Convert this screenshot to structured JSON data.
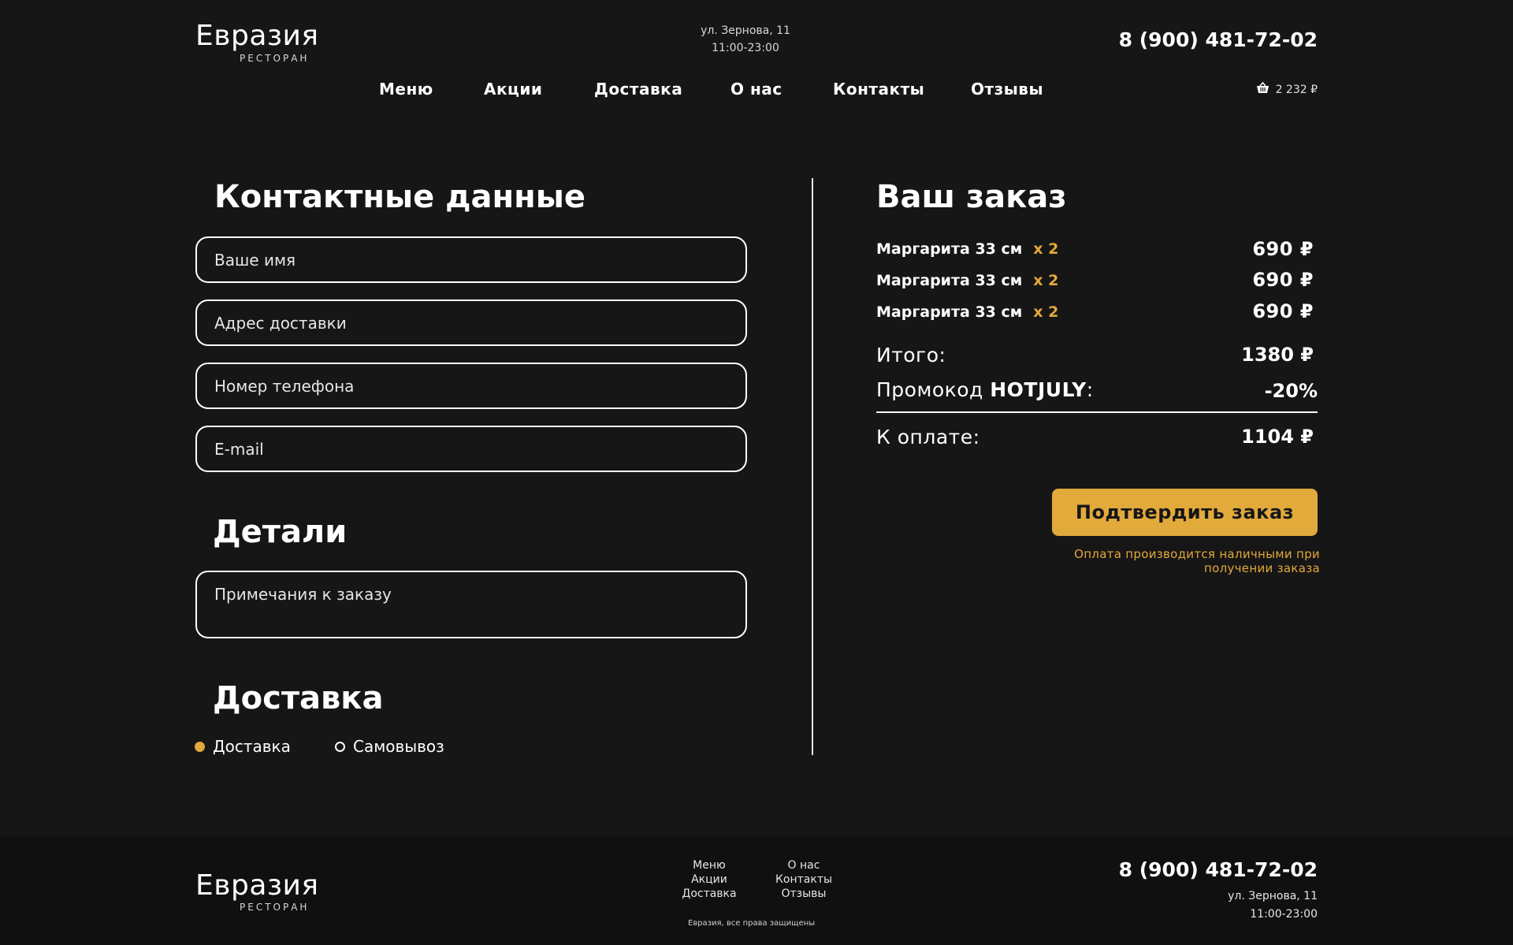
{
  "header": {
    "logo": {
      "name": "Евразия",
      "tagline": "РЕСТОРАН"
    },
    "address": "ул. Зернова, 11",
    "hours": "11:00-23:00",
    "phone": "8 (900) 481-72-02",
    "nav": [
      "Меню",
      "Акции",
      "Доставка",
      "О нас",
      "Контакты",
      "Отзывы"
    ],
    "cart_total": "2 232 ₽"
  },
  "contact": {
    "title": "Контактные данные",
    "fields": [
      {
        "placeholder": "Ваше имя",
        "value": ""
      },
      {
        "placeholder": "Адрес доставки",
        "value": ""
      },
      {
        "placeholder": "Номер телефона",
        "value": ""
      },
      {
        "placeholder": "E-mail",
        "value": ""
      }
    ]
  },
  "details": {
    "title": "Детали",
    "notes_placeholder": "Примечания к заказу"
  },
  "delivery": {
    "title": "Доставка",
    "options": [
      {
        "label": "Доставка",
        "selected": true
      },
      {
        "label": "Самовывоз",
        "selected": false
      }
    ]
  },
  "order": {
    "title": "Ваш заказ",
    "items": [
      {
        "name": "Маргарита 33 см",
        "qty": "x 2",
        "price": "690 ₽"
      },
      {
        "name": "Маргарита 33 см",
        "qty": "x 2",
        "price": "690 ₽"
      },
      {
        "name": "Маргарита 33 см",
        "qty": "x 2",
        "price": "690 ₽"
      }
    ],
    "total_label": "Итого:",
    "total_value": "1380 ₽",
    "promo_label": "Промокод ",
    "promo_code": "HOTJULY",
    "promo_colon": ":",
    "promo_value": "-20%",
    "pay_label": "К оплате:",
    "pay_value": "1104 ₽",
    "confirm_label": "Подтвердить заказ",
    "pay_note_line1": "Оплата производится наличными при",
    "pay_note_line2": "получении заказа"
  },
  "footer": {
    "logo": {
      "name": "Евразия",
      "tagline": "РЕСТОРАН"
    },
    "links_col1": [
      "Меню",
      "Акции",
      "Доставка"
    ],
    "links_col2": [
      "О нас",
      "Контакты",
      "Отзывы"
    ],
    "copyright": "Евразия, все права защищены",
    "phone": "8 (900) 481-72-02",
    "address": "ул. Зернова, 11",
    "hours": "11:00-23:00"
  },
  "colors": {
    "background": "#161616",
    "footer": "#101010",
    "accent": "#e2a93b",
    "text": "#ffffff"
  }
}
